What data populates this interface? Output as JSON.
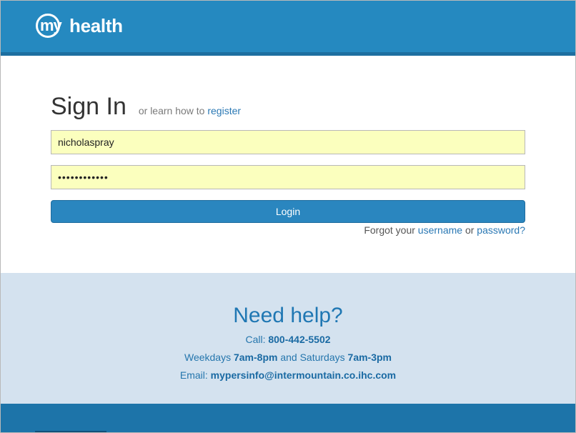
{
  "header": {
    "logo_my": "my",
    "logo_word": "health"
  },
  "signin": {
    "title": "Sign In",
    "sub_prefix": "or learn how to",
    "register_link": "register",
    "username_value": "nicholaspray",
    "password_value": "••••••••••••",
    "login_label": "Login",
    "forgot_prefix": "Forgot your",
    "forgot_username": "username",
    "forgot_or": "or",
    "forgot_password": "password?"
  },
  "help": {
    "title": "Need help?",
    "call_label": "Call:",
    "call_number": "800-442-5502",
    "weekdays_label": "Weekdays",
    "weekdays_hours": "7am-8pm",
    "and_saturdays": "and Saturdays",
    "saturday_hours": "7am-3pm",
    "email_label": "Email:",
    "email_address": "mypersinfo@intermountain.co.ihc.com"
  },
  "colors": {
    "header_blue": "#2589c0",
    "button_blue": "#2a86bf",
    "link_blue": "#2a78b4",
    "autofill_yellow": "#fbffbe",
    "help_bg": "#d4e2ef"
  }
}
